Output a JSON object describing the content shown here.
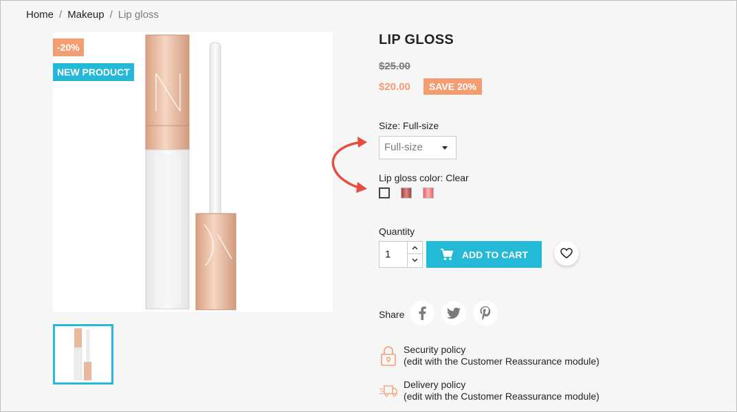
{
  "breadcrumb": {
    "items": [
      "Home",
      "Makeup"
    ],
    "current": "Lip gloss",
    "separator": "/"
  },
  "flags": {
    "discount": "-20%",
    "new": "NEW PRODUCT"
  },
  "product": {
    "title": "LIP GLOSS",
    "regular_price": "$25.00",
    "price": "$20.00",
    "save_badge": "SAVE 20%"
  },
  "variants": {
    "size_label": "Size: Full-size",
    "size_selected": "Full-size",
    "color_label": "Lip gloss color: Clear",
    "colors": [
      "Clear",
      "Red shimmer",
      "Pink"
    ]
  },
  "purchase": {
    "quantity_label": "Quantity",
    "quantity_value": "1",
    "add_to_cart": "ADD TO CART"
  },
  "share": {
    "label": "Share",
    "networks": [
      "facebook-icon",
      "twitter-icon",
      "pinterest-icon"
    ]
  },
  "reassurance": [
    {
      "title": "Security policy",
      "subtitle": "(edit with the Customer Reassurance module)",
      "icon": "lock-icon"
    },
    {
      "title": "Delivery policy",
      "subtitle": "(edit with the Customer Reassurance module)",
      "icon": "delivery-truck-icon"
    }
  ],
  "colors": {
    "accent": "#24b9d7",
    "discount": "#f39d72",
    "text": "#232323",
    "muted": "#7a7a7a",
    "annotation_arrow": "#e74c3c"
  }
}
